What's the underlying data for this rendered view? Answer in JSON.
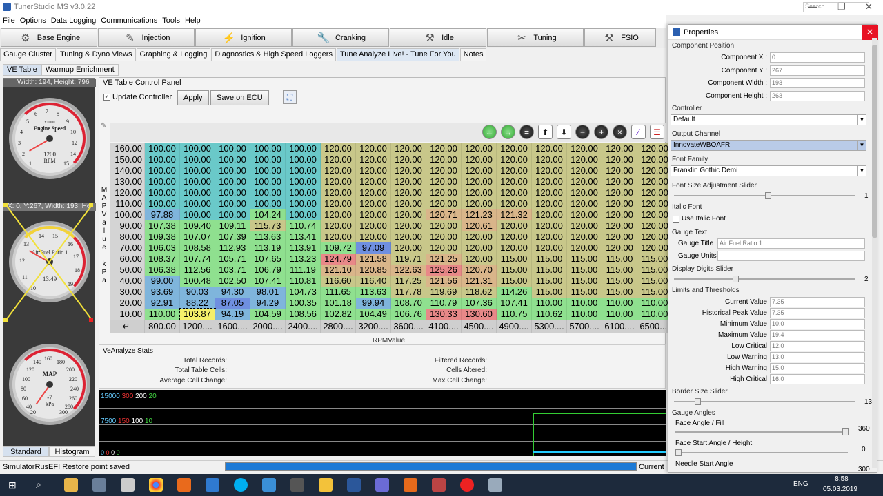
{
  "app": {
    "title": "TunerStudio MS v3.0.22",
    "search_placeholder": "Search"
  },
  "menu": [
    "File",
    "Options",
    "Data Logging",
    "Communications",
    "Tools",
    "Help"
  ],
  "toolbar": [
    "Base Engine",
    "Injection",
    "Ignition",
    "Cranking",
    "Idle",
    "Tuning",
    "FSIO"
  ],
  "tabs": [
    "Gauge Cluster",
    "Tuning & Dyno Views",
    "Graphing & Logging",
    "Diagnostics & High Speed Loggers",
    "Tune Analyze Live! - Tune For You",
    "Notes"
  ],
  "subtabs": [
    "VE Table",
    "Warmup Enrichment"
  ],
  "gauge_panel": {
    "header": "Width: 194, Height: 796",
    "header2": "X: 0, Y:267, Width: 193, He",
    "footer": [
      "Standard",
      "Histogram"
    ]
  },
  "gauges": [
    {
      "name": "Engine Speed",
      "unit": "RPM",
      "scale": "x1000",
      "value": "1200",
      "ticks": [
        "0",
        "1",
        "2",
        "3",
        "4",
        "5",
        "6",
        "7",
        "8",
        "9",
        "10",
        "11",
        "12",
        "13",
        "14",
        "15"
      ]
    },
    {
      "name": "Air:Fuel Ratio 1",
      "unit": "",
      "value": "13.49",
      "ticks": [
        "10",
        "11",
        "12",
        "13",
        "14",
        "15",
        "16",
        "17",
        "18",
        "19"
      ]
    },
    {
      "name": "MAP",
      "unit": "kPa",
      "value": "-7",
      "ticks": [
        "0",
        "20",
        "40",
        "60",
        "80",
        "100",
        "120",
        "140",
        "160",
        "180",
        "200",
        "220",
        "240",
        "260",
        "280",
        "300"
      ]
    }
  ],
  "control": {
    "legend": "VE Table Control Panel",
    "update_label": "Update Controller",
    "update_checked": true,
    "apply": "Apply",
    "save": "Save on ECU"
  },
  "ve_table": {
    "y_axis_label": "MAPValue kPa",
    "x_axis_label": "RPMValue",
    "y": [
      "160.00",
      "150.00",
      "140.00",
      "130.00",
      "120.00",
      "110.00",
      "100.00",
      "90.00",
      "80.00",
      "70.00",
      "60.00",
      "50.00",
      "40.00",
      "30.00",
      "20.00",
      "10.00"
    ],
    "x": [
      "800.00",
      "1200....",
      "1600....",
      "2000....",
      "2400....",
      "2800....",
      "3200....",
      "3600....",
      "4100....",
      "4500....",
      "4900....",
      "5300....",
      "5700....",
      "6100....",
      "6500...."
    ],
    "rows": [
      [
        "100.00",
        "100.00",
        "100.00",
        "100.00",
        "100.00",
        "120.00",
        "120.00",
        "120.00",
        "120.00",
        "120.00",
        "120.00",
        "120.00",
        "120.00",
        "120.00",
        "120.00"
      ],
      [
        "100.00",
        "100.00",
        "100.00",
        "100.00",
        "100.00",
        "120.00",
        "120.00",
        "120.00",
        "120.00",
        "120.00",
        "120.00",
        "120.00",
        "120.00",
        "120.00",
        "120.00"
      ],
      [
        "100.00",
        "100.00",
        "100.00",
        "100.00",
        "100.00",
        "120.00",
        "120.00",
        "120.00",
        "120.00",
        "120.00",
        "120.00",
        "120.00",
        "120.00",
        "120.00",
        "120.00"
      ],
      [
        "100.00",
        "100.00",
        "100.00",
        "100.00",
        "100.00",
        "120.00",
        "120.00",
        "120.00",
        "120.00",
        "120.00",
        "120.00",
        "120.00",
        "120.00",
        "120.00",
        "120.00"
      ],
      [
        "100.00",
        "100.00",
        "100.00",
        "100.00",
        "100.00",
        "120.00",
        "120.00",
        "120.00",
        "120.00",
        "120.00",
        "120.00",
        "120.00",
        "120.00",
        "120.00",
        "120.00"
      ],
      [
        "100.00",
        "100.00",
        "100.00",
        "100.00",
        "100.00",
        "120.00",
        "120.00",
        "120.00",
        "120.00",
        "120.00",
        "120.00",
        "120.00",
        "120.00",
        "120.00",
        "120.00"
      ],
      [
        "97.88",
        "100.00",
        "100.00",
        "104.24",
        "100.00",
        "120.00",
        "120.00",
        "120.00",
        "120.71",
        "121.23",
        "121.32",
        "120.00",
        "120.00",
        "120.00",
        "120.00"
      ],
      [
        "107.38",
        "109.40",
        "109.11",
        "115.73",
        "110.74",
        "120.00",
        "120.00",
        "120.00",
        "120.00",
        "120.61",
        "120.00",
        "120.00",
        "120.00",
        "120.00",
        "120.00"
      ],
      [
        "109.38",
        "107.07",
        "107.39",
        "113.63",
        "113.41",
        "120.00",
        "120.00",
        "120.00",
        "120.00",
        "120.00",
        "120.00",
        "120.00",
        "120.00",
        "120.00",
        "120.00"
      ],
      [
        "106.03",
        "108.58",
        "112.93",
        "113.19",
        "113.91",
        "109.72",
        "97.09",
        "120.00",
        "120.00",
        "120.00",
        "120.00",
        "120.00",
        "120.00",
        "120.00",
        "120.00"
      ],
      [
        "108.37",
        "107.74",
        "105.71",
        "107.65",
        "113.23",
        "124.79",
        "121.58",
        "119.71",
        "121.25",
        "120.00",
        "115.00",
        "115.00",
        "115.00",
        "115.00",
        "115.00"
      ],
      [
        "106.38",
        "112.56",
        "103.71",
        "106.79",
        "111.19",
        "121.10",
        "120.85",
        "122.63",
        "125.26",
        "120.70",
        "115.00",
        "115.00",
        "115.00",
        "115.00",
        "115.00"
      ],
      [
        "99.00",
        "100.48",
        "102.50",
        "107.41",
        "110.81",
        "116.60",
        "116.40",
        "117.25",
        "121.56",
        "121.31",
        "115.00",
        "115.00",
        "115.00",
        "115.00",
        "115.00"
      ],
      [
        "93.69",
        "90.03",
        "94.30",
        "98.01",
        "104.73",
        "111.65",
        "113.63",
        "117.78",
        "119.69",
        "118.62",
        "114.26",
        "115.00",
        "115.00",
        "115.00",
        "115.00"
      ],
      [
        "92.91",
        "88.22",
        "87.05",
        "94.29",
        "100.35",
        "101.18",
        "99.94",
        "108.70",
        "110.79",
        "107.36",
        "107.41",
        "110.00",
        "110.00",
        "110.00",
        "110.00"
      ],
      [
        "110.00",
        "103.87",
        "94.19",
        "104.59",
        "108.56",
        "102.82",
        "104.49",
        "106.76",
        "130.33",
        "130.60",
        "110.75",
        "110.62",
        "110.00",
        "110.00",
        "110.00"
      ]
    ]
  },
  "stats": {
    "title": "VeAnalyze Stats",
    "left": [
      "Total Records:",
      "Total Table Cells:",
      "Average Cell Change:"
    ],
    "right": [
      "Filtered Records:",
      "Cells Altered:",
      "Max Cell Change:"
    ]
  },
  "chart": {
    "row1": [
      "15000",
      "300",
      "200",
      "20"
    ],
    "row2": [
      "7500",
      "150",
      "100",
      "10"
    ],
    "row3": [
      "0",
      "0",
      "0",
      "0"
    ]
  },
  "status": {
    "text": "SimulatorRusEFI Restore point saved",
    "right": "Current"
  },
  "taskbar": {
    "time": "8:58",
    "date": "05.03.2019",
    "lang": "ENG"
  },
  "props": {
    "title": "Properties",
    "component_position": "Component Position",
    "fields": [
      {
        "label": "Component X :",
        "value": "0"
      },
      {
        "label": "Component Y :",
        "value": "267"
      },
      {
        "label": "Component Width :",
        "value": "193"
      },
      {
        "label": "Component Height :",
        "value": "263"
      }
    ],
    "controller_label": "Controller",
    "controller": "Default",
    "output_label": "Output Channel",
    "output": "InnovateWBOAFR",
    "font_label": "Font Family",
    "font": "Franklin Gothic Demi",
    "font_size_label": "Font Size Adjustment Slider",
    "font_size_value": "1",
    "italic_label": "Italic Font",
    "italic_check": "Use Italic Font",
    "gauge_text": "Gauge Text",
    "gauge_title_label": "Gauge Title",
    "gauge_title": "Air:Fuel Ratio 1",
    "gauge_units_label": "Gauge Units",
    "digits_label": "Display Digits Slider",
    "digits_value": "2",
    "limits_label": "Limits and Thresholds",
    "limits": [
      {
        "label": "Current Value",
        "value": "7.35"
      },
      {
        "label": "Historical Peak Value",
        "value": "7.35"
      },
      {
        "label": "Minimum Value",
        "value": "10.0"
      },
      {
        "label": "Maximum Value",
        "value": "19.4"
      },
      {
        "label": "Low Critical",
        "value": "12.0"
      },
      {
        "label": "Low Warning",
        "value": "13.0"
      },
      {
        "label": "High Warning",
        "value": "15.0"
      },
      {
        "label": "High Critical",
        "value": "16.0"
      }
    ],
    "border_label": "Border Size Slider",
    "border_value": "13",
    "angles_label": "Gauge Angles",
    "face_label": "Face Angle / Fill",
    "face_value": "360",
    "face_start_label": "Face Start Angle / Height",
    "face_start_value": "0",
    "needle_label": "Needle Start Angle",
    "needle_value": "300"
  },
  "colors": {
    "blue": "#6f8fe0",
    "cyan": "#6ac9c9",
    "green": "#8fe08f",
    "olive": "#c8c78a",
    "red": "#e88888",
    "select": "#f4f06a"
  }
}
